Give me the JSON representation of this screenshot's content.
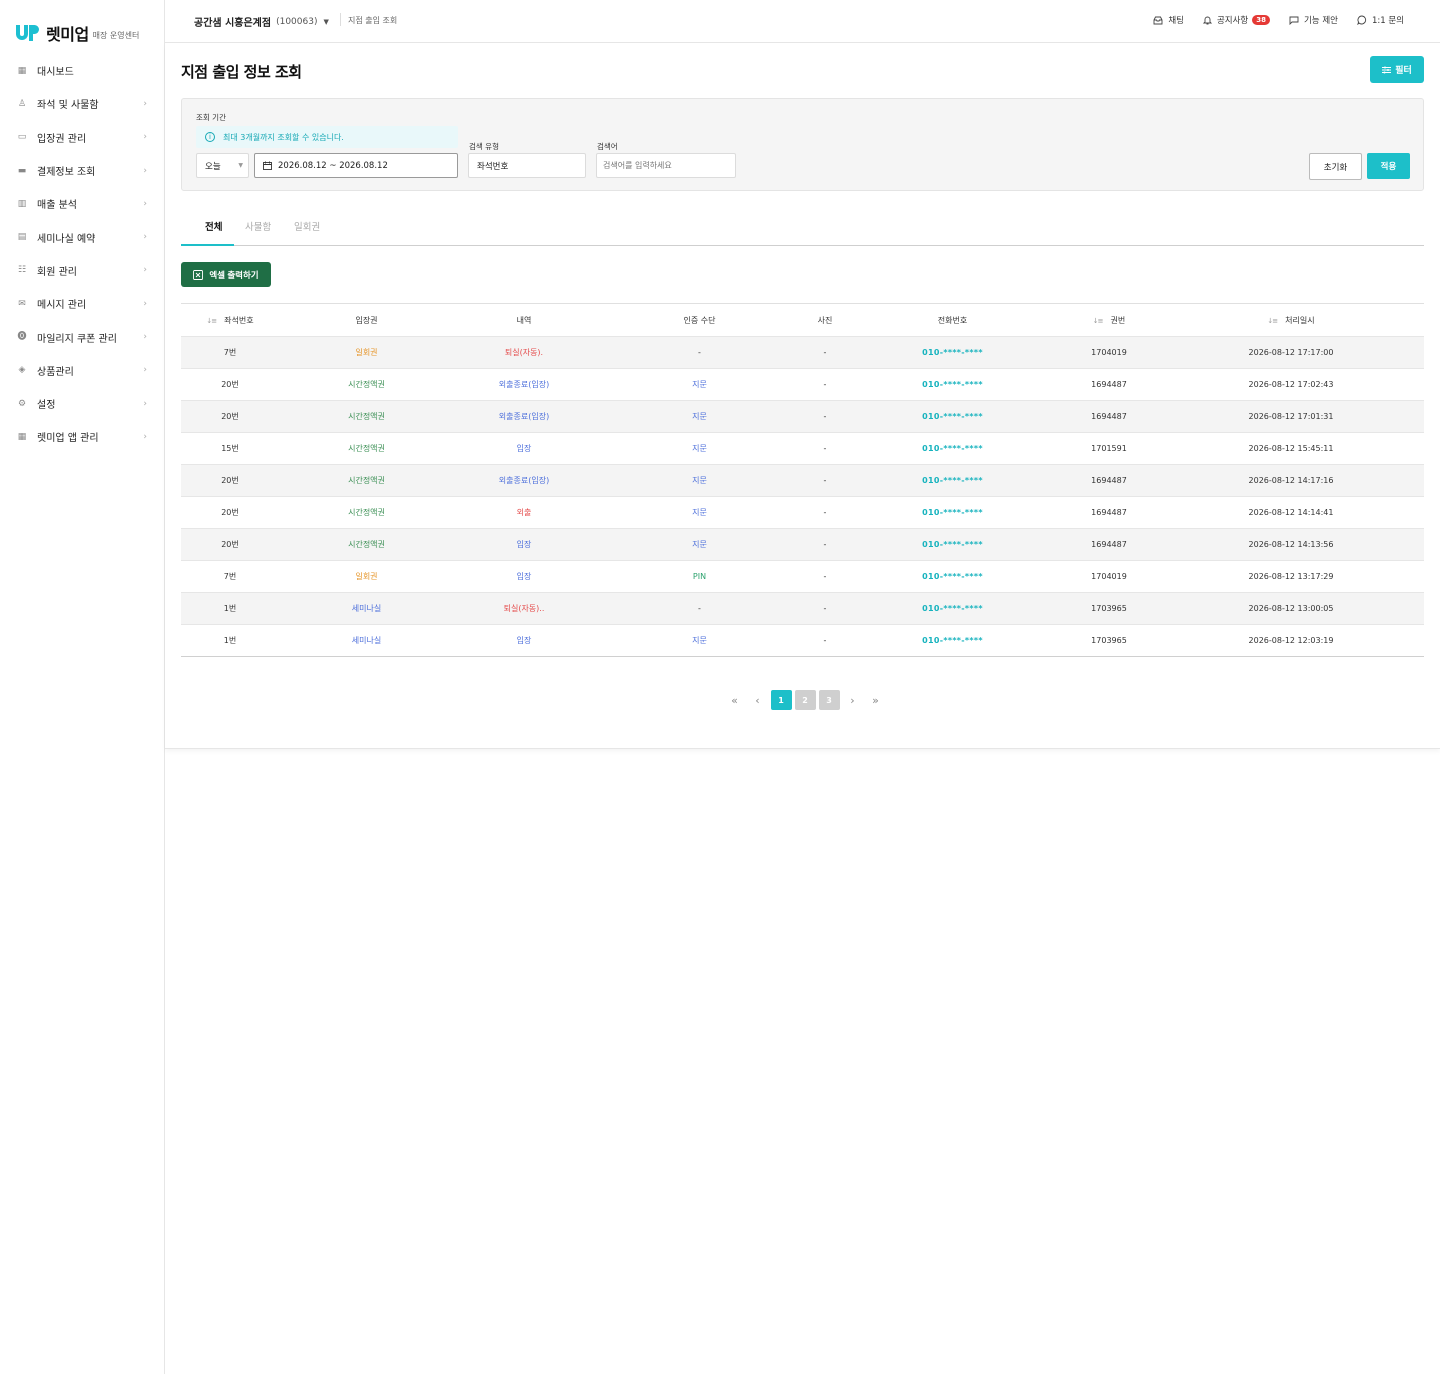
{
  "brand": {
    "name": "렛미업",
    "sub": "매장 운영센터",
    "color": "#1dbfc9"
  },
  "sidebar": {
    "items": [
      {
        "label": "대시보드",
        "icon": "grid-icon",
        "chevron": false
      },
      {
        "label": "좌석 및 사물함",
        "icon": "seat-icon",
        "chevron": true
      },
      {
        "label": "입장권 관리",
        "icon": "ticket-icon",
        "chevron": true
      },
      {
        "label": "결제정보 조회",
        "icon": "card-icon",
        "chevron": true
      },
      {
        "label": "매출 분석",
        "icon": "bar-chart-icon",
        "chevron": true
      },
      {
        "label": "세미나실 예약",
        "icon": "calendar-icon",
        "chevron": true
      },
      {
        "label": "회원 관리",
        "icon": "users-icon",
        "chevron": true
      },
      {
        "label": "메시지 관리",
        "icon": "mail-icon",
        "chevron": true
      },
      {
        "label": "마일리지 쿠폰 관리",
        "icon": "coin-icon",
        "chevron": true
      },
      {
        "label": "상품관리",
        "icon": "product-icon",
        "chevron": true
      },
      {
        "label": "설정",
        "icon": "gear-icon",
        "chevron": true
      },
      {
        "label": "렛미업 앱 관리",
        "icon": "app-grid-icon",
        "chevron": true
      }
    ]
  },
  "header": {
    "store_name": "공간샘 시흥은계점",
    "store_code": "(100063)",
    "breadcrumb": "지점 출입 조회",
    "actions": {
      "chat": "채팅",
      "notice": "공지사항",
      "notice_count": "38",
      "suggest": "기능 제안",
      "inquiry": "1:1 문의"
    }
  },
  "main": {
    "title": "지점 출입 정보 조회",
    "filter_label": "필터",
    "period_label": "조회 기간",
    "info_text": "최대 3개월까지 조회할 수 있습니다.",
    "period_select": "오늘",
    "date_range": "2026.08.12 ~ 2026.08.12",
    "search_type_label": "검색 유형",
    "search_type_value": "좌석번호",
    "search_term_label": "검색어",
    "search_placeholder": "검색어를 입력하세요",
    "reset_label": "초기화",
    "apply_label": "적용",
    "tabs": [
      "전체",
      "사물함",
      "일회권"
    ],
    "excel_label": "엑셀 출력하기"
  },
  "table": {
    "headers": [
      "좌석번호",
      "입장권",
      "내역",
      "인증 수단",
      "사진",
      "전화번호",
      "권번",
      "처리일시"
    ],
    "rows": [
      {
        "seat": "7번",
        "ticket": "일회권",
        "ticket_color": "orange",
        "history": "퇴실(자동).",
        "history_color": "red",
        "auth": "-",
        "auth_color": "none",
        "photo": "-",
        "phone": "010-****-****",
        "no": "1704019",
        "time": "2026-08-12 17:17:00"
      },
      {
        "seat": "20번",
        "ticket": "시간정액권",
        "ticket_color": "green",
        "history": "외출종료(입장)",
        "history_color": "blue",
        "auth": "지문",
        "auth_color": "blue",
        "photo": "-",
        "phone": "010-****-****",
        "no": "1694487",
        "time": "2026-08-12 17:02:43"
      },
      {
        "seat": "20번",
        "ticket": "시간정액권",
        "ticket_color": "green",
        "history": "외출종료(입장)",
        "history_color": "blue",
        "auth": "지문",
        "auth_color": "blue",
        "photo": "-",
        "phone": "010-****-****",
        "no": "1694487",
        "time": "2026-08-12 17:01:31"
      },
      {
        "seat": "15번",
        "ticket": "시간정액권",
        "ticket_color": "green",
        "history": "입장",
        "history_color": "blue",
        "auth": "지문",
        "auth_color": "blue",
        "photo": "-",
        "phone": "010-****-****",
        "no": "1701591",
        "time": "2026-08-12 15:45:11"
      },
      {
        "seat": "20번",
        "ticket": "시간정액권",
        "ticket_color": "green",
        "history": "외출종료(입장)",
        "history_color": "blue",
        "auth": "지문",
        "auth_color": "blue",
        "photo": "-",
        "phone": "010-****-****",
        "no": "1694487",
        "time": "2026-08-12 14:17:16"
      },
      {
        "seat": "20번",
        "ticket": "시간정액권",
        "ticket_color": "green",
        "history": "외출",
        "history_color": "red",
        "auth": "지문",
        "auth_color": "blue",
        "photo": "-",
        "phone": "010-****-****",
        "no": "1694487",
        "time": "2026-08-12 14:14:41"
      },
      {
        "seat": "20번",
        "ticket": "시간정액권",
        "ticket_color": "green",
        "history": "입장",
        "history_color": "blue",
        "auth": "지문",
        "auth_color": "blue",
        "photo": "-",
        "phone": "010-****-****",
        "no": "1694487",
        "time": "2026-08-12 14:13:56"
      },
      {
        "seat": "7번",
        "ticket": "일회권",
        "ticket_color": "orange",
        "history": "입장",
        "history_color": "blue",
        "auth": "PIN",
        "auth_color": "teal",
        "photo": "-",
        "phone": "010-****-****",
        "no": "1704019",
        "time": "2026-08-12 13:17:29"
      },
      {
        "seat": "1번",
        "ticket": "세미나실",
        "ticket_color": "blue",
        "history": "퇴실(자동)..",
        "history_color": "red",
        "auth": "-",
        "auth_color": "none",
        "photo": "-",
        "phone": "010-****-****",
        "no": "1703965",
        "time": "2026-08-12 13:00:05"
      },
      {
        "seat": "1번",
        "ticket": "세미나실",
        "ticket_color": "blue",
        "history": "입장",
        "history_color": "blue",
        "auth": "지문",
        "auth_color": "blue",
        "photo": "-",
        "phone": "010-****-****",
        "no": "1703965",
        "time": "2026-08-12 12:03:19"
      }
    ]
  },
  "pagination": {
    "pages": [
      "1",
      "2",
      "3"
    ],
    "current": "1",
    "first": "«",
    "prev": "‹",
    "next": "›",
    "last": "»"
  }
}
